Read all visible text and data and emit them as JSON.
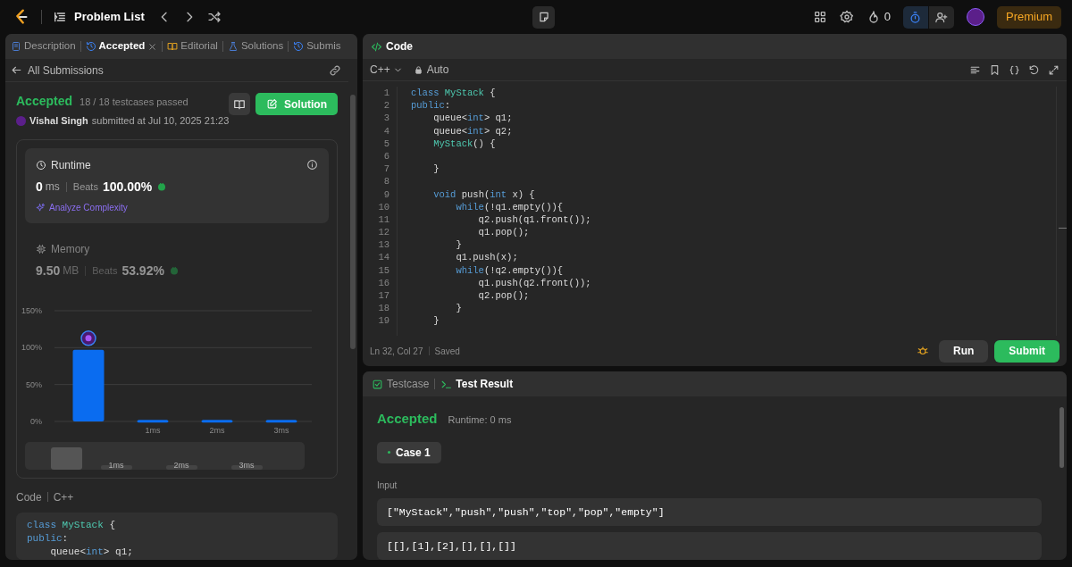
{
  "top_bar": {
    "title": "Problem List",
    "streak": "0",
    "premium": "Premium"
  },
  "left_panel": {
    "tabs": [
      {
        "label": "Description",
        "selected": false,
        "closable": false
      },
      {
        "label": "Accepted",
        "selected": true,
        "closable": true
      },
      {
        "label": "Editorial",
        "selected": false,
        "closable": false
      },
      {
        "label": "Solutions",
        "selected": false,
        "closable": false
      },
      {
        "label": "Submis",
        "selected": false,
        "closable": false
      }
    ],
    "back_link": "All Submissions",
    "result": {
      "status": "Accepted",
      "testcases": "18 / 18 testcases passed",
      "user": "Vishal Singh",
      "submitted": "submitted at Jul 10, 2025 21:23",
      "solution_button": "Solution"
    },
    "stats": [
      {
        "kind": "runtime",
        "title": "Runtime",
        "value": "0",
        "unit": "ms",
        "beats_label": "Beats",
        "beats": "100.00%",
        "selected": true,
        "link": "Analyze Complexity"
      },
      {
        "kind": "memory",
        "title": "Memory",
        "value": "9.50",
        "unit": "MB",
        "beats_label": "Beats",
        "beats": "53.92%",
        "selected": false
      }
    ],
    "chart_data": {
      "type": "bar",
      "categories": [
        null,
        "1ms",
        "2ms",
        "3ms"
      ],
      "values": [
        97,
        2,
        2,
        2
      ],
      "ylim": [
        0,
        150
      ],
      "yticks": [
        {
          "value": 0,
          "label": "0%"
        },
        {
          "value": 50,
          "label": "50%"
        },
        {
          "value": 100,
          "label": "100%"
        },
        {
          "value": 150,
          "label": "150%"
        }
      ]
    },
    "navigator_labels": [
      "1ms",
      "2ms",
      "3ms"
    ],
    "code_label": "Code",
    "language": "C++",
    "code": [
      [
        {
          "t": "class",
          "kind": "kw"
        },
        {
          "t": " MyStack",
          "kind": "type"
        },
        {
          "t": " {"
        }
      ],
      [
        {
          "t": "public",
          "kind": "kw"
        },
        {
          "t": ":"
        }
      ],
      [
        {
          "t": "    queue<"
        },
        {
          "t": "int",
          "kind": "kw"
        },
        {
          "t": "> q1;"
        }
      ]
    ]
  },
  "editor": {
    "title": "Code",
    "language": "C++",
    "mode": "Auto",
    "lines": [
      {
        "n": "1",
        "s": [
          {
            "t": "class",
            "kind": "kw"
          },
          {
            "t": " MyStack",
            "kind": "type"
          },
          {
            "t": " {"
          }
        ]
      },
      {
        "n": "2",
        "s": [
          {
            "t": "public",
            "kind": "kw"
          },
          {
            "t": ":"
          }
        ]
      },
      {
        "n": "3",
        "s": [
          {
            "t": "    queue<"
          },
          {
            "t": "int",
            "kind": "kw"
          },
          {
            "t": "> q1;"
          }
        ]
      },
      {
        "n": "4",
        "s": [
          {
            "t": "    queue<"
          },
          {
            "t": "int",
            "kind": "kw"
          },
          {
            "t": "> q2;"
          }
        ]
      },
      {
        "n": "5",
        "s": [
          {
            "t": "    MyStack",
            "kind": "type"
          },
          {
            "t": "() {"
          }
        ]
      },
      {
        "n": "6"
      },
      {
        "n": "7",
        "s": [
          {
            "t": "    }"
          }
        ]
      },
      {
        "n": "8"
      },
      {
        "n": "9",
        "s": [
          {
            "t": "    void",
            "kind": "kw"
          },
          {
            "t": " push("
          },
          {
            "t": "int",
            "kind": "kw"
          },
          {
            "t": " x) {"
          }
        ]
      },
      {
        "n": "10",
        "s": [
          {
            "t": "        while",
            "kind": "kw"
          },
          {
            "t": "(!q1.empty()){"
          }
        ]
      },
      {
        "n": "11",
        "s": [
          {
            "t": "            q2.push(q1.front());"
          }
        ]
      },
      {
        "n": "12",
        "s": [
          {
            "t": "            q1.pop();"
          }
        ]
      },
      {
        "n": "13",
        "s": [
          {
            "t": "        }"
          }
        ]
      },
      {
        "n": "14",
        "s": [
          {
            "t": "        q1.push(x);"
          }
        ]
      },
      {
        "n": "15",
        "s": [
          {
            "t": "        while",
            "kind": "kw"
          },
          {
            "t": "(!q2.empty()){"
          }
        ]
      },
      {
        "n": "16",
        "s": [
          {
            "t": "            q1.push(q2.front());"
          }
        ]
      },
      {
        "n": "17",
        "s": [
          {
            "t": "            q2.pop();"
          }
        ]
      },
      {
        "n": "18",
        "s": [
          {
            "t": "        }"
          }
        ]
      },
      {
        "n": "19",
        "s": [
          {
            "t": "    }"
          }
        ]
      }
    ],
    "status": "Ln 32, Col 27",
    "saved": "Saved",
    "run": "Run",
    "submit": "Submit"
  },
  "test_panel": {
    "tabs": [
      {
        "label": "Testcase",
        "selected": false
      },
      {
        "label": "Test Result",
        "selected": true
      }
    ],
    "status": "Accepted",
    "runtime": "Runtime: 0 ms",
    "cases": [
      {
        "label": "Case 1",
        "selected": true
      }
    ],
    "input_label": "Input",
    "inputs": [
      "[\"MyStack\",\"push\",\"push\",\"top\",\"pop\",\"empty\"]",
      "[[],[1],[2],[],[],[]]"
    ]
  }
}
